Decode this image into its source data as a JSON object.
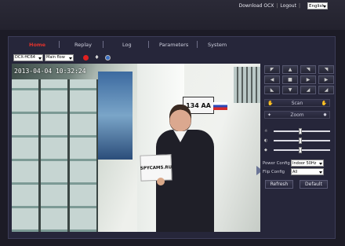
{
  "header": {
    "download": "Download OCX",
    "separator": "|",
    "logout": "Logout",
    "language": "English"
  },
  "nav": {
    "home": "Home",
    "replay": "Replay",
    "log": "Log",
    "parameters": "Parameters",
    "system": "System"
  },
  "controls": {
    "camera": "DCX-HC64",
    "stream": "Main flow"
  },
  "video": {
    "timestamp": "2013-04-04 10:32:24",
    "sign_text": "SPYCAMS.RU",
    "plate_text": "134 AA"
  },
  "panel": {
    "scan": "Scan",
    "zoom": "Zoom",
    "power_label": "Power Config",
    "power_value": "Indoor 50Hz",
    "flip_label": "Flip Config",
    "flip_value": "All",
    "refresh": "Refresh",
    "default": "Default",
    "sliders": [
      0.45,
      0.45,
      0.45
    ]
  },
  "colors": {
    "active_nav": "#e0322c",
    "record": "#e02020",
    "accent": "#3a6fc4"
  }
}
